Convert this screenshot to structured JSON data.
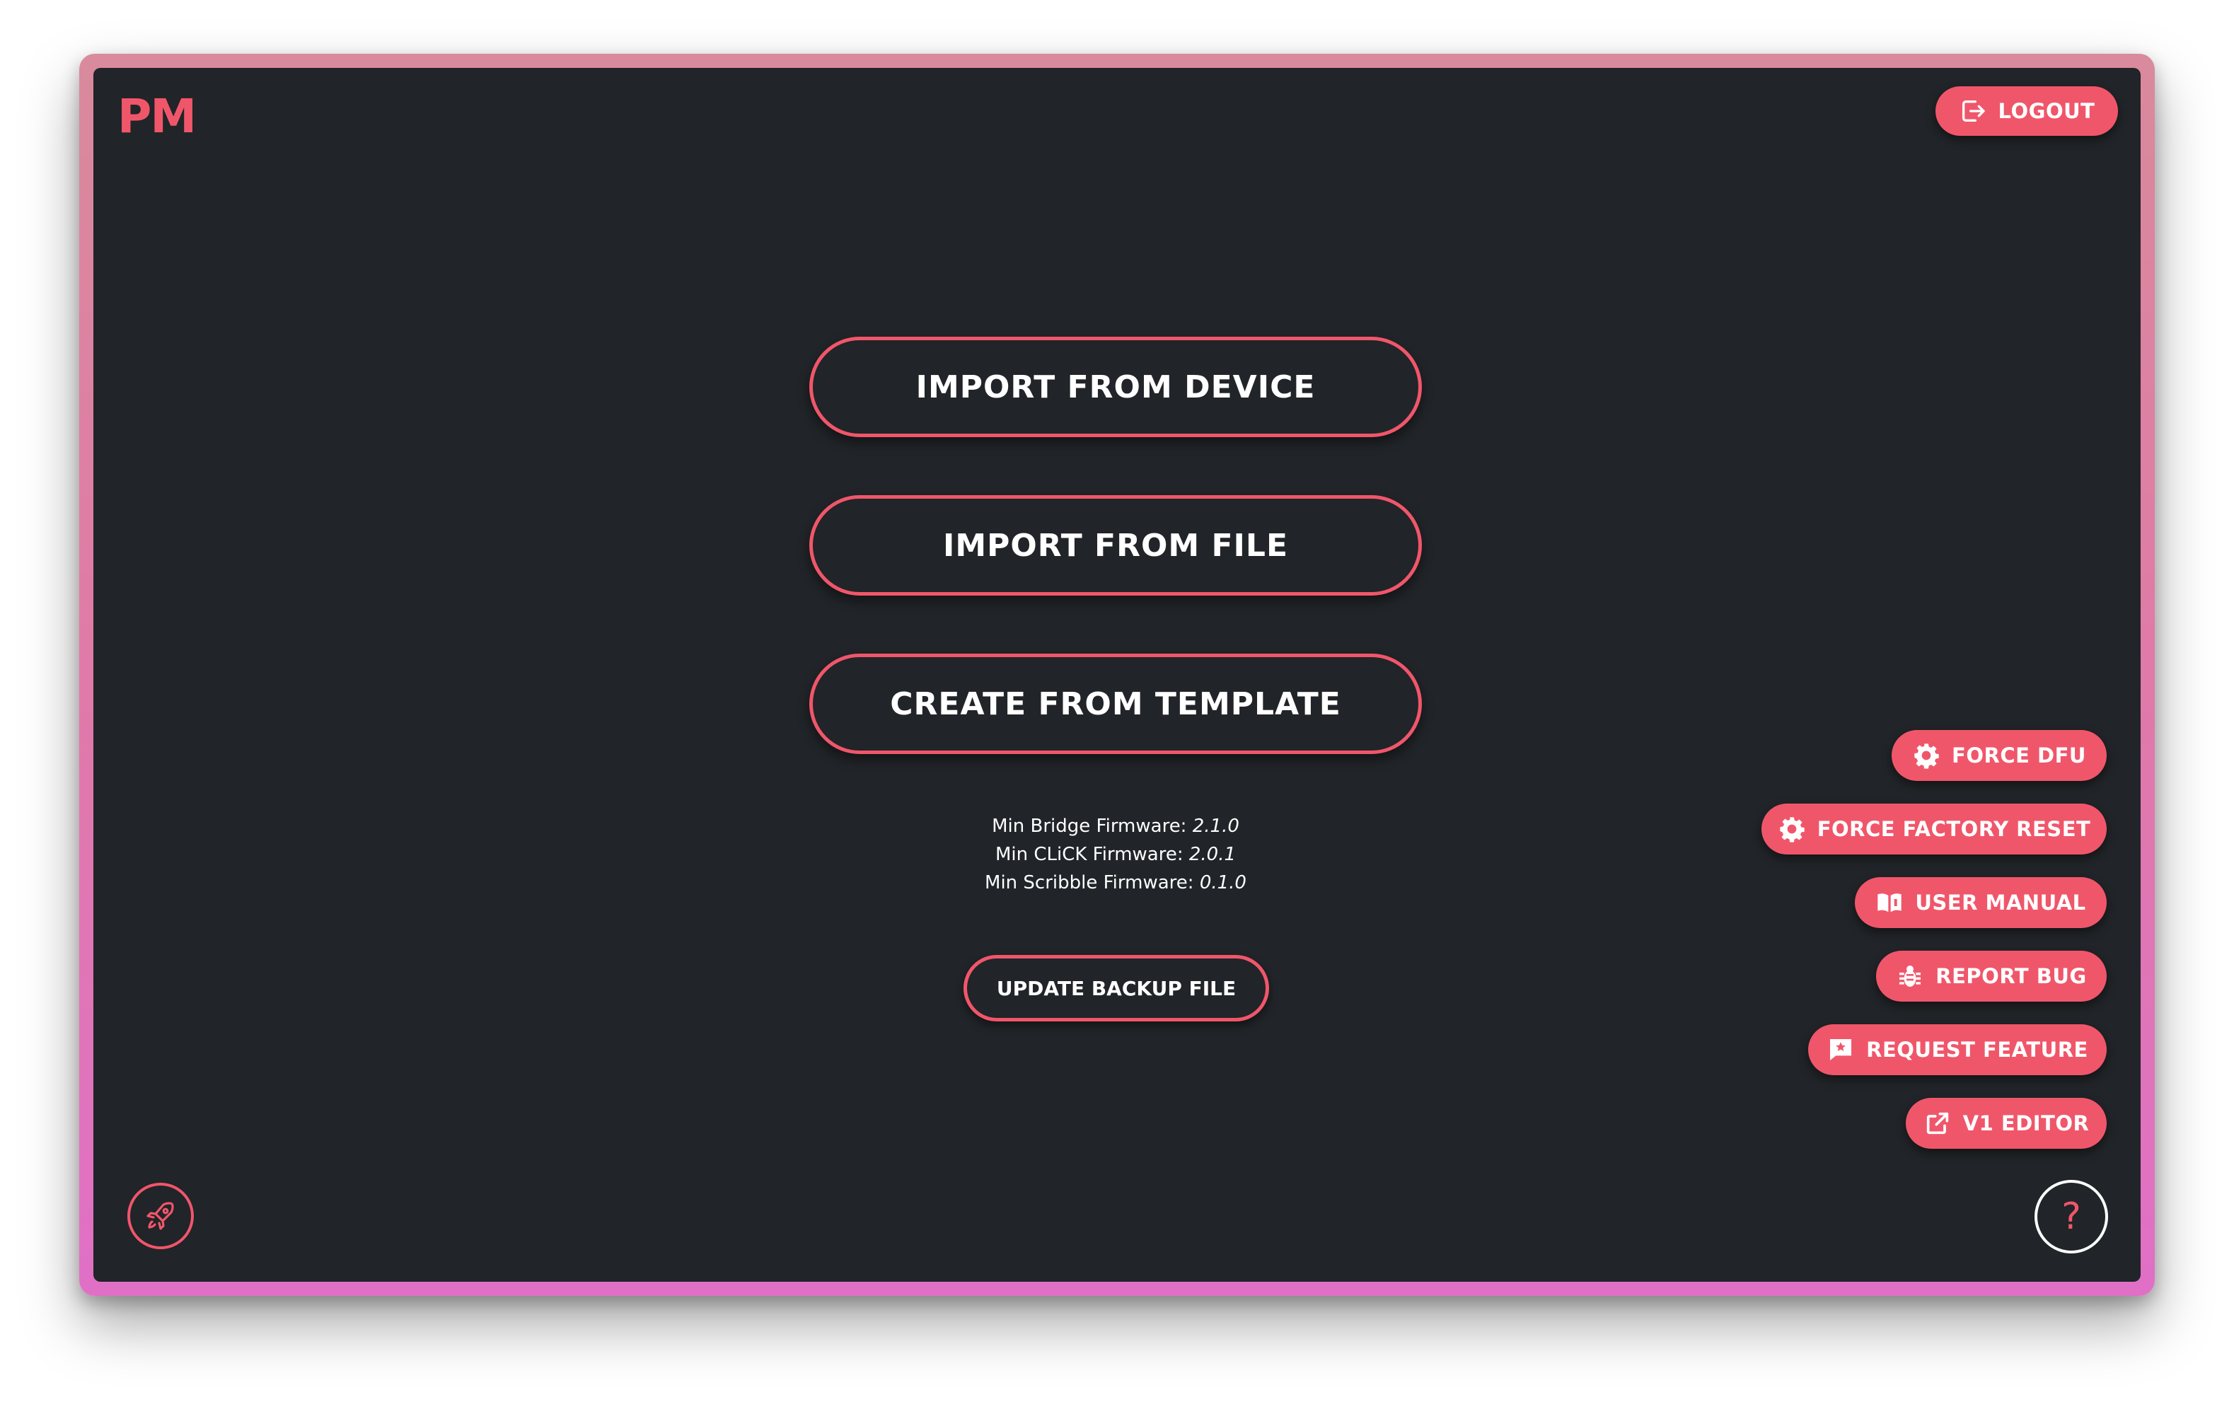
{
  "header": {
    "logo_text": "PM",
    "logout_label": "LOGOUT",
    "logout_icon": "logout-icon"
  },
  "main": {
    "import_device_label": "IMPORT FROM DEVICE",
    "import_file_label": "IMPORT FROM FILE",
    "create_template_label": "CREATE FROM TEMPLATE",
    "firmware": [
      {
        "label": "Min Bridge Firmware:",
        "version": "2.1.0"
      },
      {
        "label": "Min CLiCK Firmware:",
        "version": "2.0.1"
      },
      {
        "label": "Min Scribble Firmware:",
        "version": "0.1.0"
      }
    ],
    "update_backup_label": "UPDATE BACKUP FILE"
  },
  "side_actions": {
    "force_dfu": {
      "label": "FORCE DFU",
      "icon": "gear-icon"
    },
    "force_factory_reset": {
      "label": "FORCE FACTORY RESET",
      "icon": "gear-icon"
    },
    "user_manual": {
      "label": "USER MANUAL",
      "icon": "book-icon"
    },
    "report_bug": {
      "label": "REPORT BUG",
      "icon": "bug-icon"
    },
    "request_feature": {
      "label": "REQUEST FEATURE",
      "icon": "feature-request-icon"
    },
    "v1_editor": {
      "label": "V1 EDITOR",
      "icon": "external-link-icon"
    }
  },
  "footer": {
    "rocket_icon": "rocket-icon",
    "help_text": "?"
  },
  "colors": {
    "accent": "#f0566a",
    "background": "#212428",
    "text": "#ffffff",
    "frame_gradient_top": "#d98a9c",
    "frame_gradient_bottom": "#e070c6"
  }
}
